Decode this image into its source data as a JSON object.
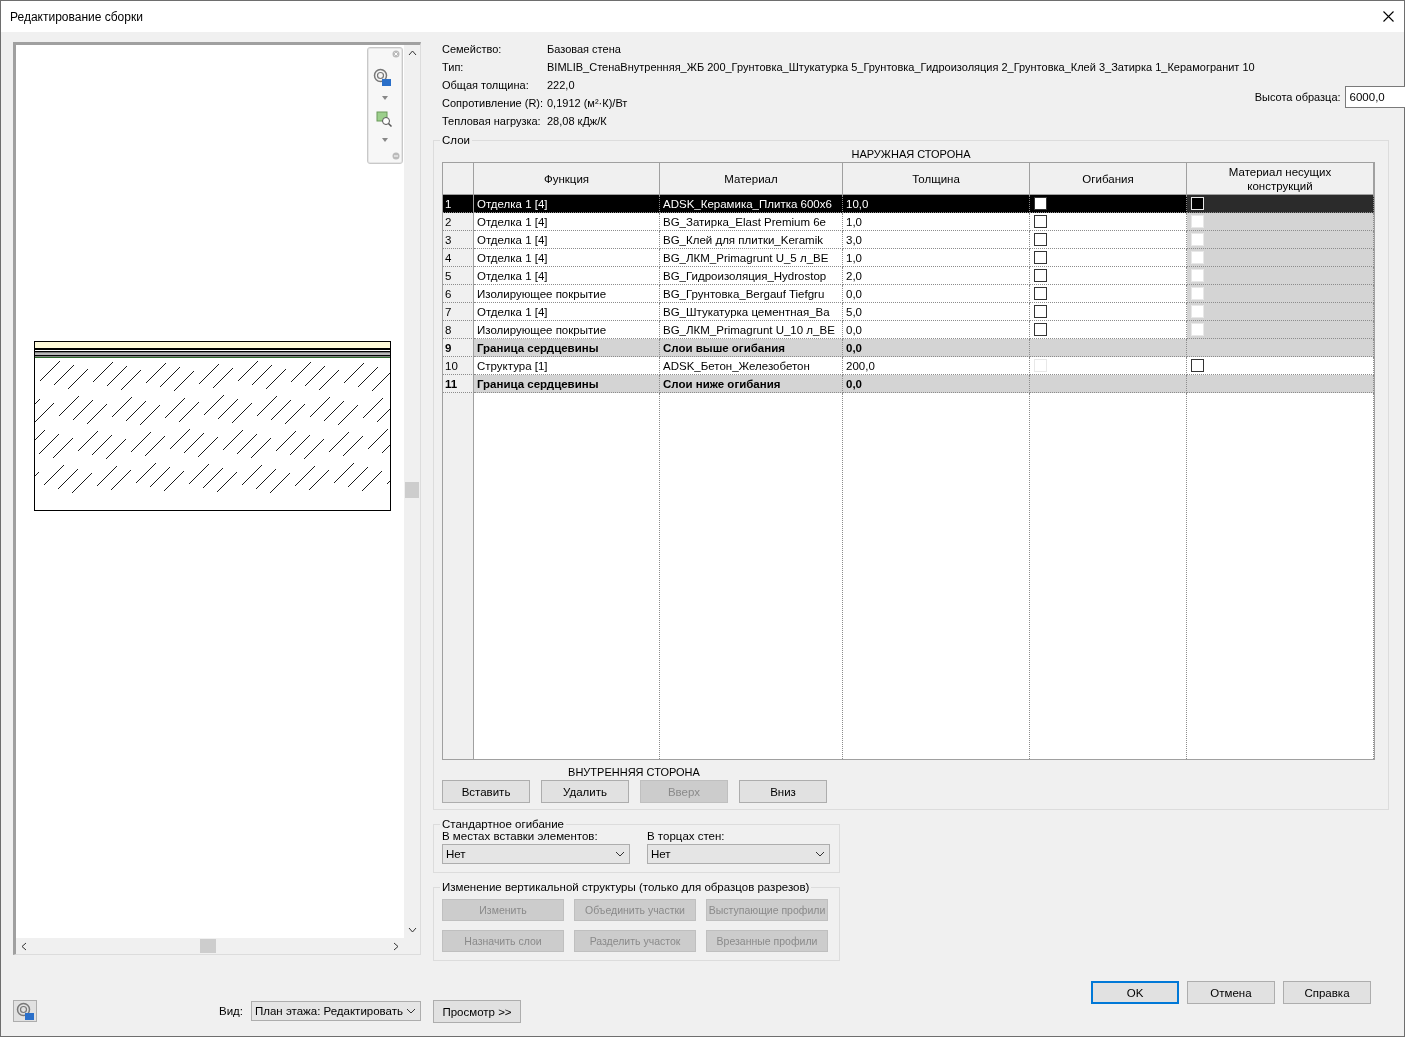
{
  "window": {
    "title": "Редактирование сборки"
  },
  "info": [
    {
      "label": "Семейство:",
      "value": "Базовая стена"
    },
    {
      "label": "Тип:",
      "value": "BIMLIB_СтенаВнутренняя_ЖБ 200_Грунтовка_Штукатурка 5_Грунтовка_Гидроизоляция 2_Грунтовка_Клей 3_Затирка 1_Керамогранит 10"
    },
    {
      "label": "Общая толщина:",
      "value": "222,0"
    },
    {
      "label": "Сопротивление (R):",
      "value": "0,1912 (м²·К)/Вт"
    },
    {
      "label": "Тепловая нагрузка:",
      "value": "28,08 кДж/К"
    }
  ],
  "sample_height": {
    "label": "Высота образца:",
    "value": "6000,0"
  },
  "layers": {
    "title": "Слои",
    "outer_side": "НАРУЖНАЯ СТОРОНА",
    "inner_side": "ВНУТРЕННЯЯ СТОРОНА",
    "columns": [
      "Функция",
      "Материал",
      "Толщина",
      "Огибания",
      "Материал несущих конструкций"
    ],
    "rows": [
      {
        "kind": "layer",
        "num": "1",
        "function": "Отделка 1 [4]",
        "material": "ADSK_Керамика_Плитка 600х6",
        "thickness": "10,0",
        "selected": true,
        "wrap_disabled": false,
        "structural_disabled": true
      },
      {
        "kind": "layer",
        "num": "2",
        "function": "Отделка 1 [4]",
        "material": "BG_Затирка_Elast Premium 6e",
        "thickness": "1,0",
        "selected": false,
        "wrap_disabled": false,
        "structural_disabled": true
      },
      {
        "kind": "layer",
        "num": "3",
        "function": "Отделка 1 [4]",
        "material": "BG_Клей для плитки_Keramik",
        "thickness": "3,0",
        "selected": false,
        "wrap_disabled": false,
        "structural_disabled": true
      },
      {
        "kind": "layer",
        "num": "4",
        "function": "Отделка 1 [4]",
        "material": "BG_ЛКМ_Primagrunt U_5 л_BE",
        "thickness": "1,0",
        "selected": false,
        "wrap_disabled": false,
        "structural_disabled": true
      },
      {
        "kind": "layer",
        "num": "5",
        "function": "Отделка 1 [4]",
        "material": "BG_Гидроизоляция_Hydrostop",
        "thickness": "2,0",
        "selected": false,
        "wrap_disabled": false,
        "structural_disabled": true
      },
      {
        "kind": "layer",
        "num": "6",
        "function": "Изолирующее покрытие",
        "material": "BG_Грунтовка_Bergauf Tiefgru",
        "thickness": "0,0",
        "selected": false,
        "wrap_disabled": false,
        "structural_disabled": true
      },
      {
        "kind": "layer",
        "num": "7",
        "function": "Отделка 1 [4]",
        "material": "BG_Штукатурка цементная_Ba",
        "thickness": "5,0",
        "selected": false,
        "wrap_disabled": false,
        "structural_disabled": true
      },
      {
        "kind": "layer",
        "num": "8",
        "function": "Изолирующее покрытие",
        "material": "BG_ЛКМ_Primagrunt U_10 л_BE",
        "thickness": "0,0",
        "selected": false,
        "wrap_disabled": false,
        "structural_disabled": true
      },
      {
        "kind": "boundary",
        "num": "9",
        "function": "Граница сердцевины",
        "material": "Слои выше огибания",
        "thickness": "0,0",
        "selected": false
      },
      {
        "kind": "layer",
        "num": "10",
        "function": "Структура [1]",
        "material": "ADSK_Бетон_Железобетон",
        "thickness": "200,0",
        "selected": false,
        "wrap_disabled": true,
        "structural_disabled": false
      },
      {
        "kind": "boundary",
        "num": "11",
        "function": "Граница сердцевины",
        "material": "Слои ниже огибания",
        "thickness": "0,0",
        "selected": false
      }
    ],
    "buttons": [
      {
        "label": "Вставить",
        "disabled": false
      },
      {
        "label": "Удалить",
        "disabled": false
      },
      {
        "label": "Вверх",
        "disabled": true
      },
      {
        "label": "Вниз",
        "disabled": false
      }
    ]
  },
  "default_wrapping": {
    "title": "Стандартное огибание",
    "fields": [
      {
        "label": "В местах вставки элементов:",
        "value": "Нет"
      },
      {
        "label": "В торцах стен:",
        "value": "Нет"
      }
    ]
  },
  "vertical_structure": {
    "title": "Изменение вертикальной структуры (только для образцов разрезов)",
    "buttons": [
      {
        "label": "Изменить",
        "disabled": true
      },
      {
        "label": "Объединить участки",
        "disabled": true
      },
      {
        "label": "Выступающие профили",
        "disabled": true
      },
      {
        "label": "Назначить слои",
        "disabled": true
      },
      {
        "label": "Разделить участок",
        "disabled": true
      },
      {
        "label": "Врезанные профили",
        "disabled": true
      }
    ]
  },
  "view": {
    "label": "Вид:",
    "value": "План этажа: Редактировать"
  },
  "preview_button": "Просмотр >>",
  "dialog_buttons": [
    {
      "label": "OK",
      "default": true
    },
    {
      "label": "Отмена",
      "default": false
    },
    {
      "label": "Справка",
      "default": false
    }
  ]
}
